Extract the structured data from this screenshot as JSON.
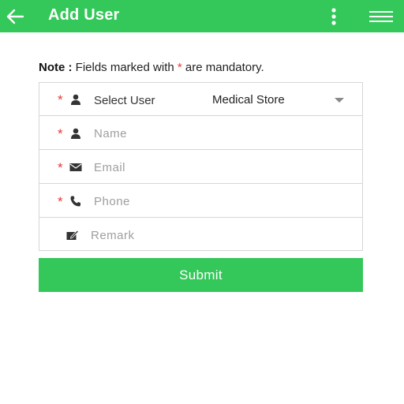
{
  "appbar": {
    "title": "Add User",
    "back_icon": "arrow-left-icon",
    "more_icon": "more-vertical-icon",
    "menu_icon": "hamburger-menu-icon",
    "color": "#34c759"
  },
  "note": {
    "prefix": "Note :",
    "text_before": " Fields marked with ",
    "asterisk": "*",
    "text_after": " are mandatory."
  },
  "form": {
    "select_user": {
      "required_mark": "*",
      "icon": "person-icon",
      "label": "Select User",
      "value": "Medical Store",
      "dropdown_icon": "caret-down-icon"
    },
    "name": {
      "required_mark": "*",
      "icon": "person-icon",
      "placeholder": "Name",
      "value": ""
    },
    "email": {
      "required_mark": "*",
      "icon": "envelope-icon",
      "placeholder": "Email",
      "value": ""
    },
    "phone": {
      "required_mark": "*",
      "icon": "phone-icon",
      "placeholder": "Phone",
      "value": ""
    },
    "remark": {
      "icon": "edit-note-icon",
      "placeholder": "Remark",
      "value": ""
    }
  },
  "submit": {
    "label": "Submit"
  },
  "colors": {
    "accent": "#34c759",
    "required": "#e53935",
    "border": "#d6d6d6"
  }
}
